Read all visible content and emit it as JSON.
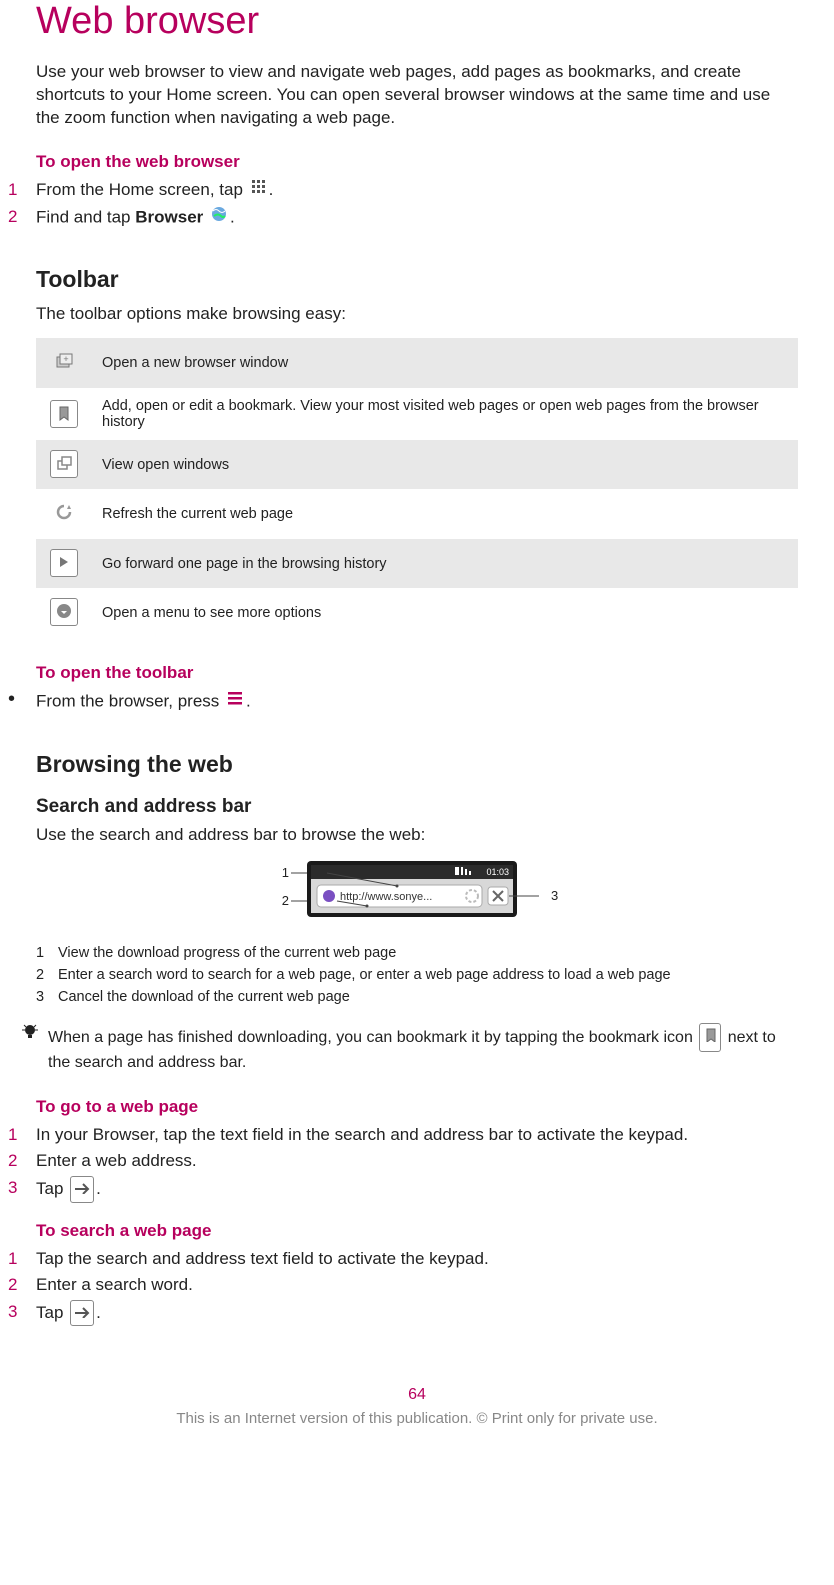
{
  "title": "Web browser",
  "intro": "Use your web browser to view and navigate web pages, add pages as bookmarks, and create shortcuts to your Home screen. You can open several browser windows at the same time and use the zoom function when navigating a web page.",
  "open_browser": {
    "heading": "To open the web browser",
    "steps": [
      {
        "n": "1",
        "pre": "From the Home screen, tap ",
        "icon": "grid-icon",
        "post": "."
      },
      {
        "n": "2",
        "pre": "Find and tap ",
        "bold": "Browser",
        "mid": " ",
        "icon": "globe-icon",
        "post": "."
      }
    ]
  },
  "toolbar": {
    "heading": "Toolbar",
    "lead": "The toolbar options make browsing easy:",
    "rows": [
      {
        "icon": "new-window-icon",
        "text": "Open a new browser window",
        "shade": true
      },
      {
        "icon": "bookmark-icon",
        "text": "Add, open or edit a bookmark. View your most visited web pages or open web pages from the browser history",
        "shade": false
      },
      {
        "icon": "windows-icon",
        "text": "View open windows",
        "shade": true
      },
      {
        "icon": "refresh-icon",
        "text": "Refresh the current web page",
        "shade": false
      },
      {
        "icon": "forward-icon",
        "text": "Go forward one page in the browsing history",
        "shade": true
      },
      {
        "icon": "more-icon",
        "text": "Open a menu to see more options",
        "shade": false
      }
    ]
  },
  "open_toolbar": {
    "heading": "To open the toolbar",
    "step": {
      "pre": "From the browser, press ",
      "icon": "menu-icon",
      "post": "."
    }
  },
  "browsing": {
    "heading": "Browsing the web",
    "sub": "Search and address bar",
    "lead": "Use the search and address bar to browse the web:"
  },
  "figure": {
    "labels": {
      "l1": "1",
      "l2": "2",
      "l3": "3"
    },
    "status": "01:03",
    "url": "http://www.sonye..."
  },
  "legend": [
    {
      "n": "1",
      "text": "View the download progress of the current web page"
    },
    {
      "n": "2",
      "text": "Enter a search word to search for a web page, or enter a web page address to load a web page"
    },
    {
      "n": "3",
      "text": "Cancel the download of the current web page"
    }
  ],
  "tip": {
    "pre": "When a page has finished downloading, you can bookmark it by tapping the bookmark icon ",
    "icon": "bookmark-icon",
    "post": " next to the search and address bar."
  },
  "goto": {
    "heading": "To go to a web page",
    "steps": [
      {
        "n": "1",
        "text": "In your Browser, tap the text field in the search and address bar to activate the keypad."
      },
      {
        "n": "2",
        "text": "Enter a web address."
      },
      {
        "n": "3",
        "pre": "Tap ",
        "icon": "arrow-right-icon",
        "post": "."
      }
    ]
  },
  "search": {
    "heading": "To search a web page",
    "steps": [
      {
        "n": "1",
        "text": "Tap the search and address text field to activate the keypad."
      },
      {
        "n": "2",
        "text": "Enter a search word."
      },
      {
        "n": "3",
        "pre": "Tap ",
        "icon": "arrow-right-icon",
        "post": "."
      }
    ]
  },
  "page_number": "64",
  "footer": "This is an Internet version of this publication. © Print only for private use."
}
